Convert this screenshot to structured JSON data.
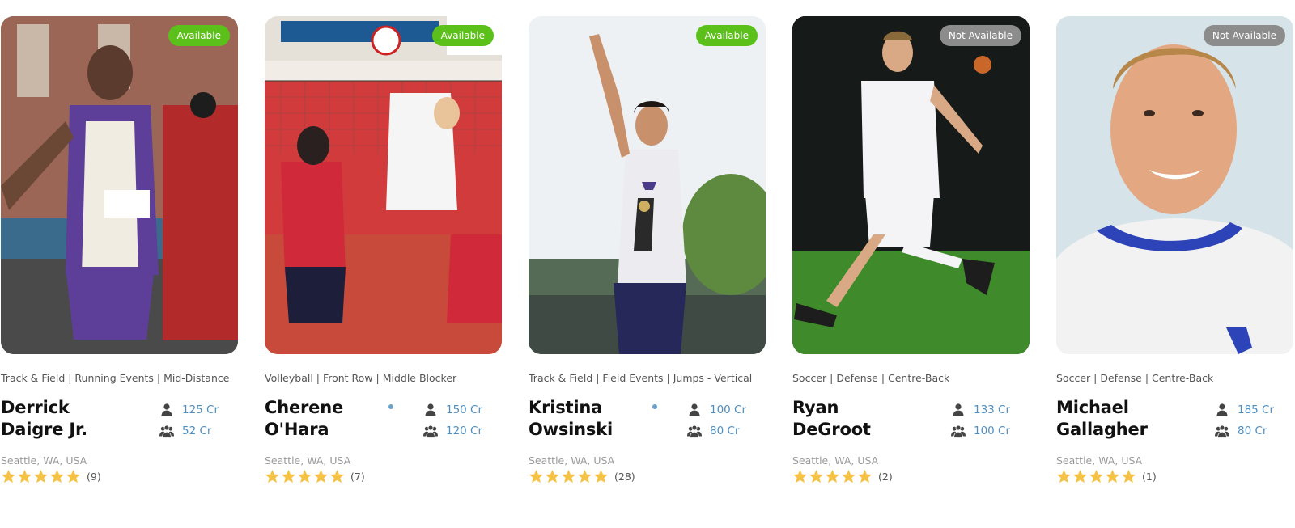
{
  "cards": [
    {
      "badge": "Available",
      "category": "Track & Field | Running Events | Mid-Distance",
      "name_line1": "Derrick",
      "name_line2": "Daigre Jr.",
      "online": false,
      "single_rate": "125 Cr",
      "group_rate": "52 Cr",
      "location": "Seattle, WA, USA",
      "rating": 5,
      "review_count": "(9)"
    },
    {
      "badge": "Available",
      "category": "Volleyball | Front Row | Middle Blocker",
      "name_line1": "Cherene",
      "name_line2": "O'Hara",
      "online": true,
      "single_rate": "150 Cr",
      "group_rate": "120 Cr",
      "location": "Seattle, WA, USA",
      "rating": 5,
      "review_count": "(7)"
    },
    {
      "badge": "Available",
      "category": "Track & Field | Field Events | Jumps - Vertical",
      "name_line1": "Kristina",
      "name_line2": "Owsinski",
      "online": true,
      "single_rate": "100 Cr",
      "group_rate": "80 Cr",
      "location": "Seattle, WA, USA",
      "rating": 5,
      "review_count": "(28)"
    },
    {
      "badge": "Not Available",
      "category": "Soccer | Defense | Centre-Back",
      "name_line1": "Ryan",
      "name_line2": "DeGroot",
      "online": false,
      "single_rate": "133 Cr",
      "group_rate": "100 Cr",
      "location": "Seattle, WA, USA",
      "rating": 5,
      "review_count": "(2)"
    },
    {
      "badge": "Not Available",
      "category": "Soccer | Defense | Centre-Back",
      "name_line1": "Michael",
      "name_line2": "Gallagher",
      "online": false,
      "single_rate": "185 Cr",
      "group_rate": "80 Cr",
      "location": "Seattle, WA, USA",
      "rating": 5,
      "review_count": "(1)"
    }
  ],
  "colors": {
    "available": "#5cc01a",
    "not_available": "#8c8c8c",
    "rate_text": "#4f8fc0",
    "star": "#f6c244",
    "online_dot": "#6aa3c8"
  },
  "icons": {
    "single_rate": "person-icon",
    "group_rate": "group-icon",
    "rating": "star-icon"
  }
}
